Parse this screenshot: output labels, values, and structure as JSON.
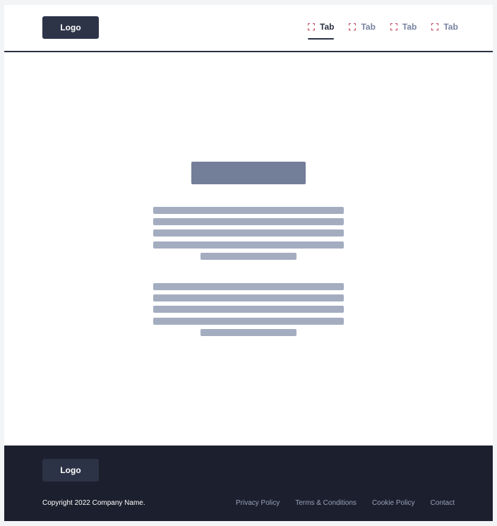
{
  "header": {
    "logo_label": "Logo",
    "tabs": [
      {
        "label": "Tab",
        "active": true,
        "icon": "expand-icon"
      },
      {
        "label": "Tab",
        "active": false,
        "icon": "expand-icon"
      },
      {
        "label": "Tab",
        "active": false,
        "icon": "expand-icon"
      },
      {
        "label": "Tab",
        "active": false,
        "icon": "expand-icon"
      }
    ]
  },
  "footer": {
    "logo_label": "Logo",
    "copyright": "Copyright 2022 Company Name.",
    "links": [
      "Privacy Policy",
      "Terms & Conditions",
      "Cookie Policy",
      "Contact"
    ]
  },
  "colors": {
    "accent_dark": "#2d3448",
    "footer_bg": "#1c1f2d",
    "placeholder_title": "#737e98",
    "placeholder_text": "#a4adc0",
    "tab_icon": "#c0475a"
  }
}
